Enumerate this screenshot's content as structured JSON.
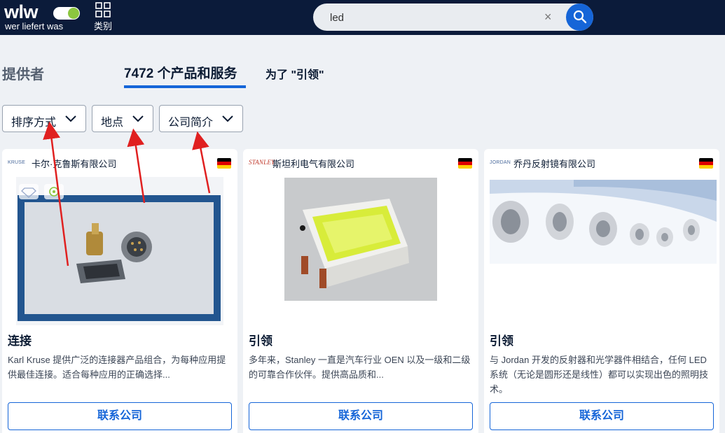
{
  "header": {
    "logo_word": "wlw",
    "logo_sub": "wer liefert was",
    "categories_label": "类别",
    "search_value": "led",
    "search_clear_icon": "close-icon",
    "search_button_icon": "search-icon",
    "colors": {
      "bar": "#0b1b3a",
      "accent": "#1565d8",
      "logo_green": "#8cc63f"
    }
  },
  "tabs": {
    "providers": "提供者",
    "products": "7472 个产品和服务",
    "for_text": "为了 \"引领\""
  },
  "filters": [
    {
      "label": "排序方式"
    },
    {
      "label": "地点"
    },
    {
      "label": "公司简介"
    }
  ],
  "cards": [
    {
      "logo_text": "KRUSE",
      "company": "卡尔·克鲁斯有限公司",
      "country_flag": "germany-flag",
      "badges": [
        "diamond-icon",
        "gear-badge-icon"
      ],
      "title": "连接",
      "description": "Karl Kruse 提供广泛的连接器产品组合，为每种应用提供最佳连接。适合每种应用的正确选择...",
      "button": "联系公司"
    },
    {
      "logo_text": "STANLEY",
      "company": "斯坦利电气有限公司",
      "country_flag": "germany-flag",
      "title": "引领",
      "description": "多年来，Stanley 一直是汽车行业 OEN 以及一级和二级的可靠合作伙伴。提供高品质和...",
      "button": "联系公司"
    },
    {
      "logo_text": "JORDAN",
      "company": "乔丹反射镜有限公司",
      "country_flag": "germany-flag",
      "title": "引领",
      "description": "与 Jordan 开发的反射器和光学器件相结合，任何 LED 系统（无论是圆形还是线性）都可以实现出色的照明技术。",
      "button": "联系公司"
    }
  ]
}
